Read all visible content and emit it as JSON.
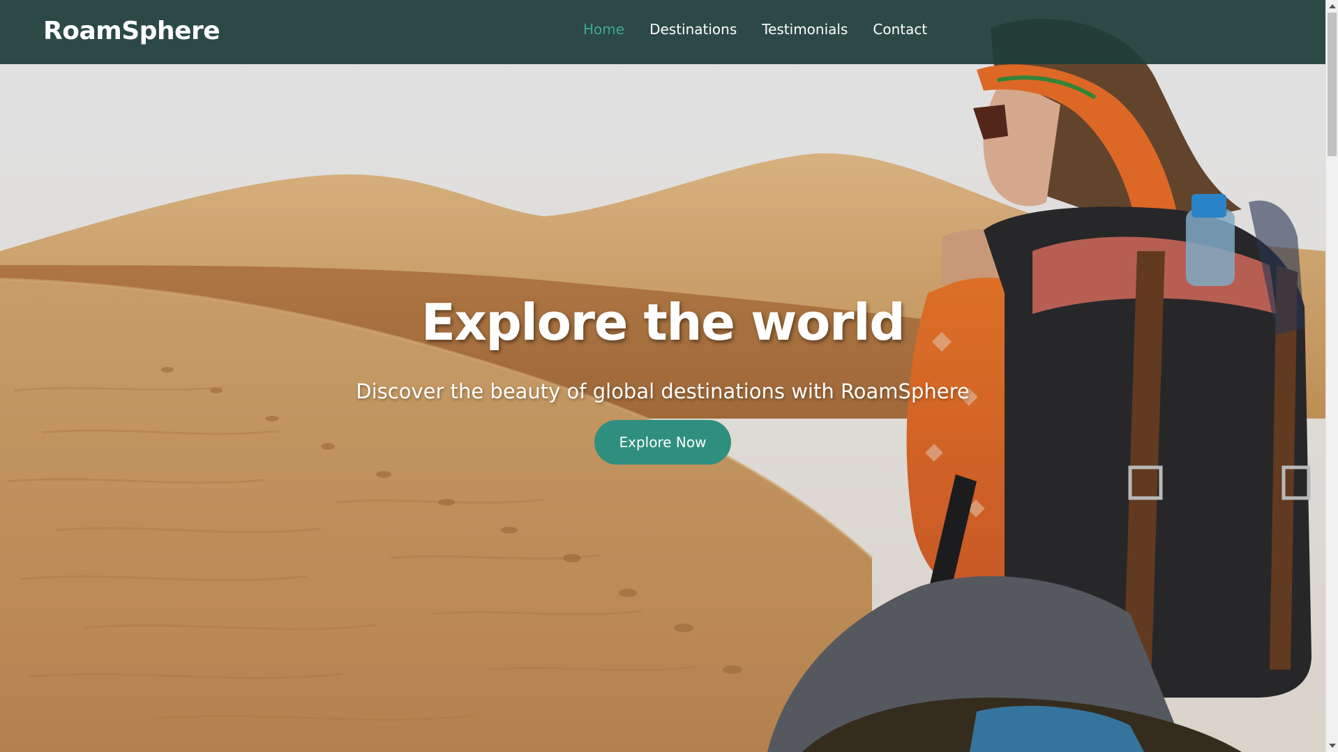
{
  "brand": "RoamSphere",
  "nav": {
    "items": [
      {
        "label": "Home",
        "active": true
      },
      {
        "label": "Destinations",
        "active": false
      },
      {
        "label": "Testimonials",
        "active": false
      },
      {
        "label": "Contact",
        "active": false
      }
    ]
  },
  "hero": {
    "title": "Explore the world",
    "subtitle": "Discover the beauty of global destinations with RoamSphere",
    "button_label": "Explore Now"
  },
  "colors": {
    "navbar": "#1e3d39",
    "accent": "#3fa792",
    "button": "#2f8f7f"
  },
  "icons": {
    "scroll_up": "chevron-up-icon",
    "scroll_down": "chevron-down-icon"
  }
}
